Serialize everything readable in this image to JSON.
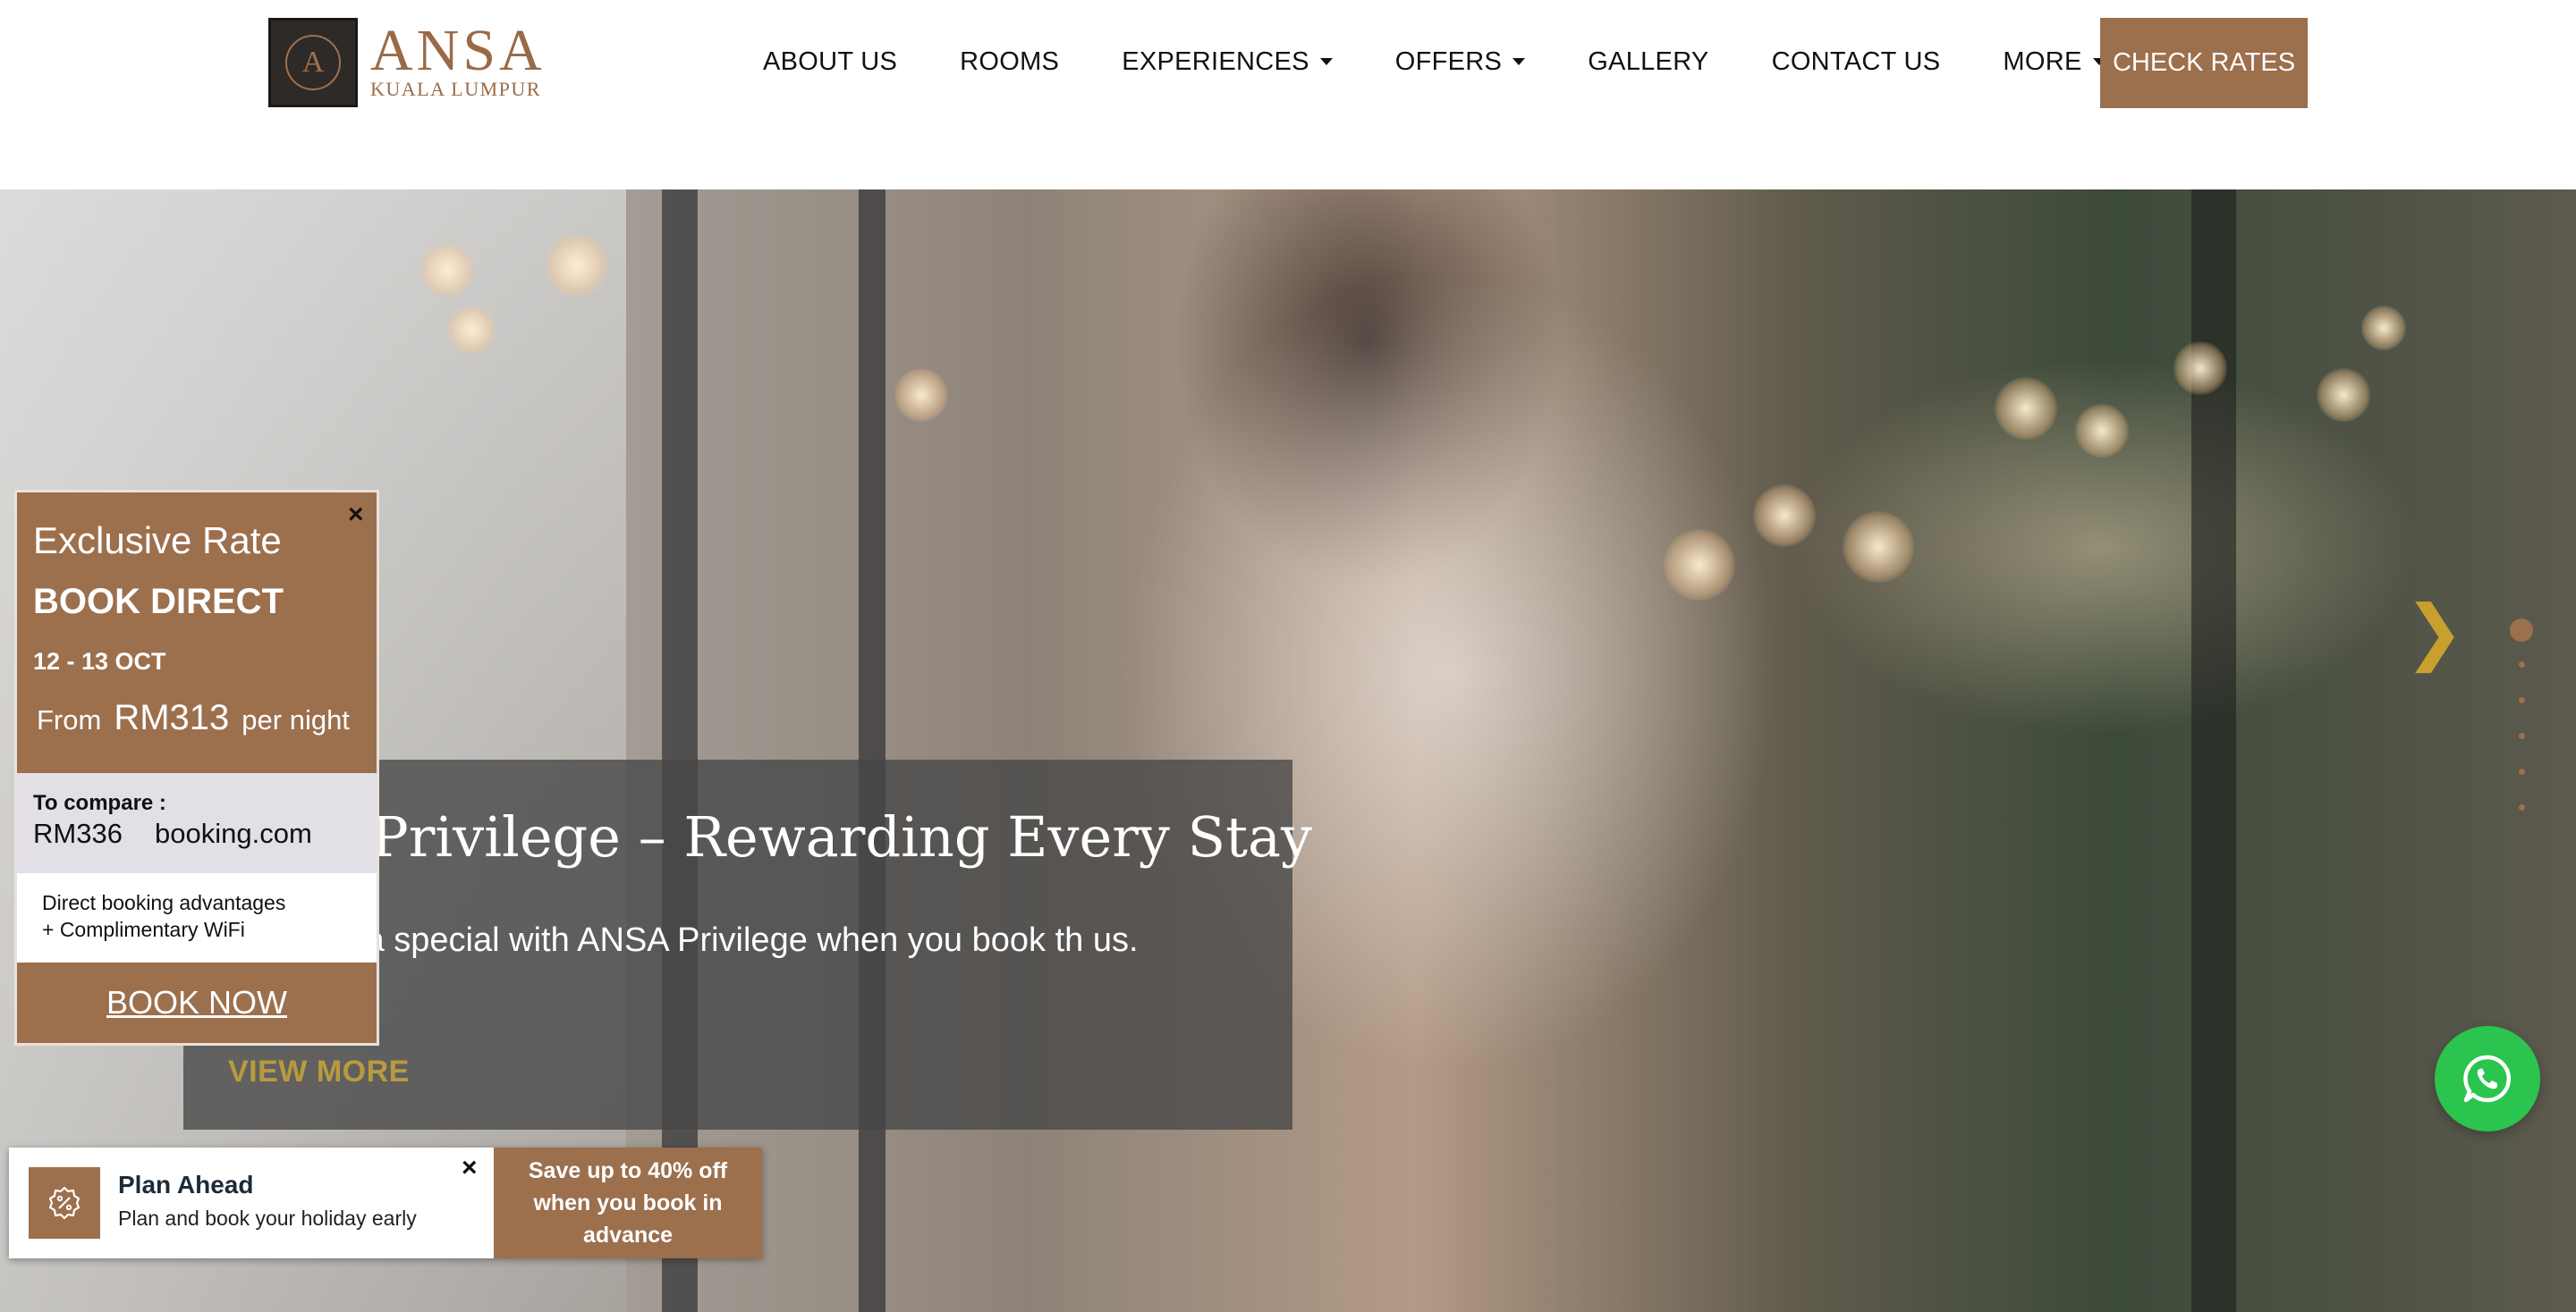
{
  "header": {
    "logo": {
      "name": "ANSA",
      "subtitle": "KUALA LUMPUR",
      "monogram": "A"
    },
    "nav": [
      {
        "label": "ABOUT US",
        "has_dropdown": false
      },
      {
        "label": "ROOMS",
        "has_dropdown": false
      },
      {
        "label": "EXPERIENCES",
        "has_dropdown": true
      },
      {
        "label": "OFFERS",
        "has_dropdown": true
      },
      {
        "label": "GALLERY",
        "has_dropdown": false
      },
      {
        "label": "CONTACT US",
        "has_dropdown": false
      },
      {
        "label": "MORE",
        "has_dropdown": true
      }
    ],
    "cta_label": "CHECK RATES"
  },
  "hero": {
    "caption_title": "Privilege – Rewarding Every Stay",
    "caption_text": "stay extra special with ANSA Privilege when you book th us.",
    "caption_link": "VIEW MORE",
    "next_icon": "chevron-right-icon",
    "slide_count": 6,
    "active_slide": 1
  },
  "rate_widget": {
    "close_label": "×",
    "label": "Exclusive Rate",
    "book_direct": "BOOK DIRECT",
    "dates": "12 - 13 OCT",
    "from_label": "From",
    "price": "RM313",
    "per_night": "per night",
    "compare_label": "To compare :",
    "compare_price": "RM336",
    "compare_site": "booking.com",
    "perk_1": "Direct booking advantages",
    "perk_2": "+ Complimentary WiFi",
    "book_now": "BOOK NOW"
  },
  "plan_ahead": {
    "icon": "discount-badge-icon",
    "title": "Plan Ahead",
    "subtitle": "Plan and book your holiday early",
    "close_label": "×",
    "cta": "Save up to 40% off when you book in advance"
  },
  "whatsapp": {
    "icon": "whatsapp-icon"
  },
  "colors": {
    "brand_brown": "#9c6f4d",
    "link_gold": "#b89a40",
    "whatsapp_green": "#2bc44e",
    "compare_bg": "#e2e0e6"
  }
}
